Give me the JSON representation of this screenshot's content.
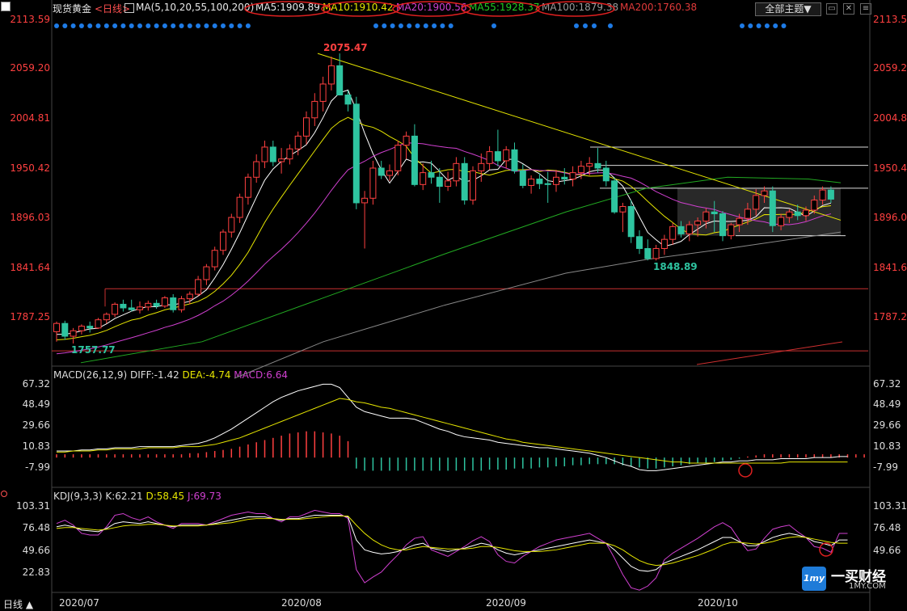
{
  "header": {
    "symbol": "现货黄金",
    "period": "<日线>",
    "ma_def": "MA(5,10,20,55,100,200)",
    "ma5": "MA5:1909.89",
    "ma10": "MA10:1910.42",
    "ma20": "MA20:1900.56",
    "ma55": "MA55:1928.37",
    "ma100": "MA100:1879.38",
    "ma200": "MA200:1760.38",
    "main_select": "全部主题▼",
    "btn_restore": "▭",
    "btn_close": "✕",
    "btn_menu": "≡"
  },
  "colors": {
    "up": "#ff4040",
    "down": "#2ec4a0",
    "ma5": "#ffffff",
    "ma10": "#e6e600",
    "ma20": "#d040d0",
    "ma55": "#22aa22",
    "ma100": "#888888",
    "ma200": "#d03030",
    "trend": "#e6e600"
  },
  "main_axis": {
    "ticks": [
      "2113.59",
      "2059.20",
      "2004.81",
      "1950.42",
      "1896.03",
      "1841.64",
      "1787.25"
    ],
    "range": [
      1730,
      2113.59
    ]
  },
  "macd": {
    "title": "MACD(26,12,9)",
    "diff": "DIFF:-1.42",
    "dea": "DEA:-4.74",
    "macd": "MACD:6.64",
    "ticks": [
      "67.32",
      "48.49",
      "29.66",
      "10.83",
      "-7.99"
    ]
  },
  "kdj": {
    "title": "KDJ(9,3,3)",
    "k": "K:62.21",
    "d": "D:58.45",
    "j": "J:69.73",
    "ticks": [
      "103.31",
      "76.48",
      "49.66",
      "22.83"
    ]
  },
  "x_labels": [
    "2020/07",
    "2020/08",
    "2020/09",
    "2020/10"
  ],
  "period_button": "日线 ▲",
  "logo": {
    "brand": "一买财经",
    "url": "1MY.COM",
    "badge": "1my"
  },
  "chart_data": {
    "type": "candlestick",
    "annotations": {
      "high": "2075.47",
      "low1": "1757.77",
      "low2": "1848.89"
    },
    "horizontal_levels": [
      1973,
      1953,
      1928,
      1876,
      1818,
      1750
    ],
    "candles": [
      {
        "o": 1771,
        "h": 1782,
        "l": 1760,
        "c": 1780
      },
      {
        "o": 1780,
        "h": 1783,
        "l": 1762,
        "c": 1766
      },
      {
        "o": 1766,
        "h": 1775,
        "l": 1758,
        "c": 1772
      },
      {
        "o": 1772,
        "h": 1779,
        "l": 1768,
        "c": 1777
      },
      {
        "o": 1777,
        "h": 1782,
        "l": 1770,
        "c": 1775
      },
      {
        "o": 1775,
        "h": 1786,
        "l": 1774,
        "c": 1784
      },
      {
        "o": 1784,
        "h": 1792,
        "l": 1780,
        "c": 1790
      },
      {
        "o": 1790,
        "h": 1803,
        "l": 1787,
        "c": 1801
      },
      {
        "o": 1801,
        "h": 1806,
        "l": 1793,
        "c": 1797
      },
      {
        "o": 1797,
        "h": 1806,
        "l": 1793,
        "c": 1795
      },
      {
        "o": 1795,
        "h": 1804,
        "l": 1791,
        "c": 1798
      },
      {
        "o": 1798,
        "h": 1805,
        "l": 1794,
        "c": 1802
      },
      {
        "o": 1802,
        "h": 1806,
        "l": 1796,
        "c": 1799
      },
      {
        "o": 1799,
        "h": 1810,
        "l": 1797,
        "c": 1808
      },
      {
        "o": 1808,
        "h": 1812,
        "l": 1792,
        "c": 1795
      },
      {
        "o": 1795,
        "h": 1810,
        "l": 1792,
        "c": 1807
      },
      {
        "o": 1807,
        "h": 1815,
        "l": 1801,
        "c": 1812
      },
      {
        "o": 1812,
        "h": 1832,
        "l": 1810,
        "c": 1828
      },
      {
        "o": 1828,
        "h": 1845,
        "l": 1822,
        "c": 1842
      },
      {
        "o": 1842,
        "h": 1864,
        "l": 1838,
        "c": 1860
      },
      {
        "o": 1860,
        "h": 1883,
        "l": 1855,
        "c": 1880
      },
      {
        "o": 1880,
        "h": 1900,
        "l": 1874,
        "c": 1896
      },
      {
        "o": 1896,
        "h": 1922,
        "l": 1890,
        "c": 1918
      },
      {
        "o": 1918,
        "h": 1944,
        "l": 1910,
        "c": 1940
      },
      {
        "o": 1940,
        "h": 1965,
        "l": 1934,
        "c": 1957
      },
      {
        "o": 1957,
        "h": 1980,
        "l": 1950,
        "c": 1973
      },
      {
        "o": 1973,
        "h": 1980,
        "l": 1952,
        "c": 1957
      },
      {
        "o": 1957,
        "h": 1972,
        "l": 1944,
        "c": 1960
      },
      {
        "o": 1960,
        "h": 1976,
        "l": 1954,
        "c": 1971
      },
      {
        "o": 1971,
        "h": 1990,
        "l": 1964,
        "c": 1985
      },
      {
        "o": 1985,
        "h": 2012,
        "l": 1976,
        "c": 2005
      },
      {
        "o": 2005,
        "h": 2032,
        "l": 1996,
        "c": 2023
      },
      {
        "o": 2023,
        "h": 2050,
        "l": 2012,
        "c": 2042
      },
      {
        "o": 2042,
        "h": 2072,
        "l": 2035,
        "c": 2062
      },
      {
        "o": 2062,
        "h": 2075.47,
        "l": 2050,
        "c": 2030
      },
      {
        "o": 2030,
        "h": 2035,
        "l": 2012,
        "c": 2020
      },
      {
        "o": 2020,
        "h": 2028,
        "l": 1905,
        "c": 1912
      },
      {
        "o": 1912,
        "h": 1925,
        "l": 1862,
        "c": 1917
      },
      {
        "o": 1917,
        "h": 1958,
        "l": 1910,
        "c": 1950
      },
      {
        "o": 1950,
        "h": 1958,
        "l": 1938,
        "c": 1942
      },
      {
        "o": 1942,
        "h": 1954,
        "l": 1936,
        "c": 1947
      },
      {
        "o": 1947,
        "h": 1980,
        "l": 1942,
        "c": 1975
      },
      {
        "o": 1975,
        "h": 1990,
        "l": 1960,
        "c": 1985
      },
      {
        "o": 1985,
        "h": 1998,
        "l": 1930,
        "c": 1932
      },
      {
        "o": 1932,
        "h": 1955,
        "l": 1926,
        "c": 1945
      },
      {
        "o": 1945,
        "h": 1958,
        "l": 1933,
        "c": 1940
      },
      {
        "o": 1940,
        "h": 1950,
        "l": 1912,
        "c": 1930
      },
      {
        "o": 1930,
        "h": 1946,
        "l": 1925,
        "c": 1936
      },
      {
        "o": 1936,
        "h": 1962,
        "l": 1930,
        "c": 1955
      },
      {
        "o": 1955,
        "h": 1962,
        "l": 1910,
        "c": 1915
      },
      {
        "o": 1915,
        "h": 1952,
        "l": 1910,
        "c": 1947
      },
      {
        "o": 1947,
        "h": 1966,
        "l": 1935,
        "c": 1955
      },
      {
        "o": 1955,
        "h": 1974,
        "l": 1948,
        "c": 1968
      },
      {
        "o": 1968,
        "h": 1992,
        "l": 1952,
        "c": 1958
      },
      {
        "o": 1958,
        "h": 1974,
        "l": 1950,
        "c": 1970
      },
      {
        "o": 1970,
        "h": 1978,
        "l": 1944,
        "c": 1947
      },
      {
        "o": 1947,
        "h": 1954,
        "l": 1928,
        "c": 1931
      },
      {
        "o": 1931,
        "h": 1942,
        "l": 1922,
        "c": 1938
      },
      {
        "o": 1938,
        "h": 1944,
        "l": 1927,
        "c": 1933
      },
      {
        "o": 1933,
        "h": 1946,
        "l": 1912,
        "c": 1932
      },
      {
        "o": 1932,
        "h": 1948,
        "l": 1924,
        "c": 1940
      },
      {
        "o": 1940,
        "h": 1950,
        "l": 1932,
        "c": 1938
      },
      {
        "o": 1938,
        "h": 1952,
        "l": 1930,
        "c": 1945
      },
      {
        "o": 1945,
        "h": 1958,
        "l": 1938,
        "c": 1952
      },
      {
        "o": 1952,
        "h": 1962,
        "l": 1942,
        "c": 1955
      },
      {
        "o": 1955,
        "h": 1972,
        "l": 1945,
        "c": 1950
      },
      {
        "o": 1950,
        "h": 1958,
        "l": 1930,
        "c": 1936
      },
      {
        "o": 1936,
        "h": 1940,
        "l": 1900,
        "c": 1902
      },
      {
        "o": 1902,
        "h": 1912,
        "l": 1880,
        "c": 1908
      },
      {
        "o": 1908,
        "h": 1915,
        "l": 1868,
        "c": 1875
      },
      {
        "o": 1875,
        "h": 1882,
        "l": 1856,
        "c": 1862
      },
      {
        "o": 1862,
        "h": 1872,
        "l": 1849,
        "c": 1851
      },
      {
        "o": 1851,
        "h": 1866,
        "l": 1848.89,
        "c": 1862
      },
      {
        "o": 1862,
        "h": 1877,
        "l": 1855,
        "c": 1872
      },
      {
        "o": 1872,
        "h": 1890,
        "l": 1866,
        "c": 1886
      },
      {
        "o": 1886,
        "h": 1892,
        "l": 1874,
        "c": 1878
      },
      {
        "o": 1878,
        "h": 1892,
        "l": 1870,
        "c": 1888
      },
      {
        "o": 1888,
        "h": 1896,
        "l": 1875,
        "c": 1892
      },
      {
        "o": 1892,
        "h": 1906,
        "l": 1884,
        "c": 1902
      },
      {
        "o": 1902,
        "h": 1914,
        "l": 1880,
        "c": 1900
      },
      {
        "o": 1900,
        "h": 1903,
        "l": 1870,
        "c": 1876
      },
      {
        "o": 1876,
        "h": 1890,
        "l": 1872,
        "c": 1888
      },
      {
        "o": 1888,
        "h": 1900,
        "l": 1880,
        "c": 1895
      },
      {
        "o": 1895,
        "h": 1912,
        "l": 1888,
        "c": 1905
      },
      {
        "o": 1905,
        "h": 1927,
        "l": 1898,
        "c": 1920
      },
      {
        "o": 1920,
        "h": 1930,
        "l": 1912,
        "c": 1925
      },
      {
        "o": 1925,
        "h": 1930,
        "l": 1880,
        "c": 1887
      },
      {
        "o": 1887,
        "h": 1900,
        "l": 1882,
        "c": 1896
      },
      {
        "o": 1896,
        "h": 1905,
        "l": 1890,
        "c": 1902
      },
      {
        "o": 1902,
        "h": 1910,
        "l": 1893,
        "c": 1898
      },
      {
        "o": 1898,
        "h": 1908,
        "l": 1892,
        "c": 1904
      },
      {
        "o": 1904,
        "h": 1920,
        "l": 1900,
        "c": 1915
      },
      {
        "o": 1915,
        "h": 1930,
        "l": 1910,
        "c": 1926
      },
      {
        "o": 1926,
        "h": 1930,
        "l": 1912,
        "c": 1916
      }
    ],
    "macd_hist": [
      3,
      3,
      3,
      3,
      3,
      3,
      3,
      3,
      3,
      3,
      3,
      3,
      3,
      3,
      3,
      3,
      4,
      4,
      5,
      6,
      7,
      8,
      10,
      12,
      14,
      16,
      18,
      20,
      22,
      23,
      24,
      24,
      23,
      22,
      20,
      15,
      -10,
      -12,
      -12,
      -12,
      -12,
      -12,
      -12,
      -12,
      -12,
      -12,
      -12,
      -12,
      -12,
      -12,
      -12,
      -12,
      -11,
      -11,
      -11,
      -10,
      -10,
      -10,
      -9,
      -9,
      -8,
      -8,
      -7,
      -7,
      -6,
      -6,
      -6,
      -6,
      -7,
      -8,
      -9,
      -10,
      -10,
      -9,
      -8,
      -7,
      -6,
      -5,
      -5,
      -4,
      -3,
      -2,
      -1,
      1,
      2,
      3,
      3,
      3,
      3,
      3,
      3,
      3,
      3,
      3,
      3,
      3,
      3,
      3
    ],
    "macd_diff": [
      6,
      6,
      6,
      7,
      7,
      8,
      8,
      9,
      9,
      9,
      10,
      10,
      10,
      10,
      10,
      11,
      12,
      13,
      15,
      18,
      22,
      26,
      31,
      36,
      41,
      46,
      51,
      55,
      58,
      61,
      63,
      65,
      67,
      67,
      64,
      55,
      46,
      42,
      40,
      38,
      36,
      36,
      36,
      35,
      32,
      29,
      26,
      24,
      21,
      19,
      18,
      17,
      16,
      14,
      13,
      12,
      11,
      10,
      9,
      9,
      8,
      7,
      6,
      5,
      4,
      2,
      0,
      -3,
      -6,
      -8,
      -11,
      -12,
      -12,
      -11,
      -10,
      -9,
      -8,
      -7,
      -6,
      -5,
      -4,
      -4,
      -3,
      -3,
      -2,
      -2,
      -2,
      -1,
      -1,
      -1,
      -1,
      0,
      0,
      0,
      1,
      1
    ],
    "macd_dea": [
      5,
      5,
      6,
      6,
      6,
      7,
      7,
      8,
      8,
      8,
      8,
      9,
      9,
      9,
      9,
      10,
      10,
      10,
      11,
      12,
      14,
      16,
      18,
      21,
      24,
      27,
      30,
      33,
      36,
      39,
      42,
      45,
      48,
      51,
      54,
      53,
      51,
      50,
      48,
      46,
      45,
      43,
      41,
      39,
      37,
      35,
      33,
      31,
      29,
      27,
      25,
      23,
      21,
      19,
      17,
      16,
      14,
      13,
      12,
      11,
      10,
      9,
      8,
      7,
      6,
      5,
      4,
      3,
      2,
      1,
      0,
      -1,
      -2,
      -3,
      -4,
      -4,
      -5,
      -5,
      -5,
      -5,
      -5,
      -5,
      -5,
      -5,
      -5,
      -5,
      -5,
      -5,
      -4,
      -4,
      -4,
      -4,
      -4,
      -4,
      -4,
      -4
    ],
    "kdj_k": [
      78,
      80,
      78,
      74,
      73,
      72,
      76,
      82,
      84,
      83,
      82,
      84,
      82,
      80,
      78,
      80,
      80,
      80,
      80,
      82,
      84,
      86,
      88,
      90,
      90,
      90,
      88,
      86,
      88,
      88,
      90,
      92,
      92,
      92,
      92,
      90,
      62,
      50,
      47,
      45,
      46,
      48,
      52,
      56,
      58,
      52,
      50,
      48,
      50,
      52,
      55,
      58,
      56,
      50,
      46,
      44,
      46,
      48,
      50,
      52,
      54,
      56,
      58,
      60,
      62,
      60,
      58,
      50,
      40,
      30,
      25,
      24,
      26,
      34,
      38,
      42,
      46,
      50,
      55,
      60,
      65,
      65,
      60,
      55,
      55,
      60,
      65,
      68,
      70,
      68,
      65,
      60,
      58,
      55,
      62,
      62
    ],
    "kdj_d": [
      76,
      77,
      77,
      76,
      75,
      74,
      75,
      77,
      79,
      80,
      80,
      81,
      81,
      80,
      79,
      79,
      79,
      79,
      80,
      81,
      82,
      83,
      85,
      87,
      88,
      88,
      88,
      87,
      87,
      87,
      88,
      89,
      90,
      91,
      91,
      91,
      80,
      70,
      62,
      56,
      52,
      50,
      50,
      52,
      54,
      53,
      52,
      51,
      51,
      51,
      52,
      54,
      54,
      53,
      51,
      49,
      48,
      48,
      48,
      49,
      50,
      52,
      54,
      56,
      58,
      58,
      58,
      55,
      50,
      43,
      37,
      33,
      31,
      32,
      34,
      37,
      40,
      43,
      47,
      51,
      56,
      59,
      59,
      58,
      57,
      58,
      60,
      63,
      65,
      66,
      65,
      63,
      61,
      59,
      58,
      58
    ],
    "kdj_j": [
      82,
      86,
      80,
      70,
      68,
      68,
      78,
      92,
      94,
      89,
      86,
      90,
      84,
      80,
      76,
      82,
      82,
      82,
      80,
      84,
      88,
      92,
      94,
      96,
      94,
      94,
      88,
      84,
      90,
      90,
      94,
      98,
      96,
      94,
      94,
      88,
      26,
      10,
      17,
      23,
      34,
      44,
      56,
      64,
      66,
      50,
      46,
      42,
      48,
      54,
      61,
      66,
      60,
      44,
      36,
      34,
      42,
      48,
      54,
      58,
      62,
      64,
      66,
      68,
      70,
      64,
      58,
      40,
      20,
      4,
      1,
      6,
      16,
      38,
      46,
      52,
      58,
      64,
      71,
      78,
      83,
      77,
      62,
      49,
      51,
      64,
      75,
      78,
      80,
      72,
      65,
      54,
      52,
      47,
      70,
      70
    ]
  }
}
